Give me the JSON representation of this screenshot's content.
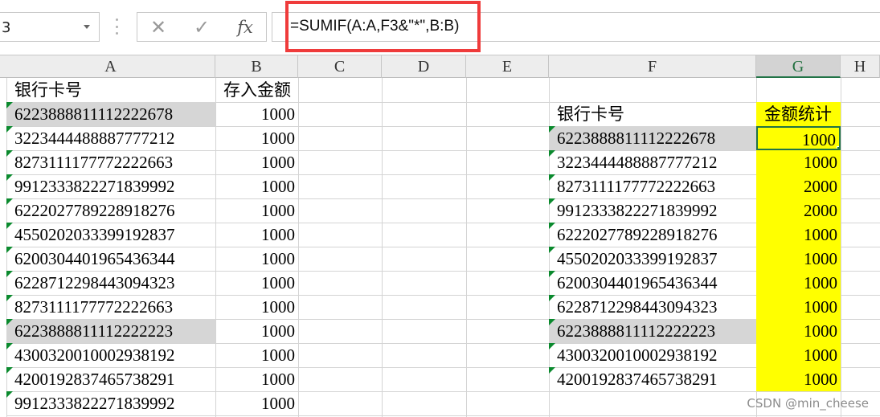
{
  "formula_bar": {
    "name_box_value": "3",
    "cancel_symbol": "✕",
    "enter_symbol": "✓",
    "fx_label": "fx",
    "formula": "=SUMIF(A:A,F3&\"*\",B:B)"
  },
  "columns": [
    "A",
    "B",
    "C",
    "D",
    "E",
    "F",
    "G",
    "H"
  ],
  "selected_column": "G",
  "sheet": {
    "col_a_header": "银行卡号",
    "col_b_header": "存入金额",
    "left_rows": [
      {
        "card": "6223888811112222678",
        "amount": "1000",
        "grey": true
      },
      {
        "card": "3223444488887777212",
        "amount": "1000",
        "grey": false
      },
      {
        "card": "8273111177772222663",
        "amount": "1000",
        "grey": false
      },
      {
        "card": "9912333822271839992",
        "amount": "1000",
        "grey": false
      },
      {
        "card": "6222027789228918276",
        "amount": "1000",
        "grey": false
      },
      {
        "card": "4550202033399192837",
        "amount": "1000",
        "grey": false
      },
      {
        "card": "6200304401965436344",
        "amount": "1000",
        "grey": false
      },
      {
        "card": "6228712298443094323",
        "amount": "1000",
        "grey": false
      },
      {
        "card": "8273111177772222663",
        "amount": "1000",
        "grey": false
      },
      {
        "card": "6223888811112222223",
        "amount": "1000",
        "grey": true
      },
      {
        "card": "4300320010002938192",
        "amount": "1000",
        "grey": false
      },
      {
        "card": "4200192837465738291",
        "amount": "1000",
        "grey": false
      },
      {
        "card": "9912333822271839992",
        "amount": "1000",
        "grey": false
      }
    ],
    "col_f_header": "银行卡号",
    "col_g_header": "金额统计",
    "right_rows": [
      {
        "card": "6223888811112222678",
        "total": "1000",
        "grey": true
      },
      {
        "card": "3223444488887777212",
        "total": "1000",
        "grey": false
      },
      {
        "card": "8273111177772222663",
        "total": "2000",
        "grey": false
      },
      {
        "card": "9912333822271839992",
        "total": "2000",
        "grey": false
      },
      {
        "card": "6222027789228918276",
        "total": "1000",
        "grey": false
      },
      {
        "card": "4550202033399192837",
        "total": "1000",
        "grey": false
      },
      {
        "card": "6200304401965436344",
        "total": "1000",
        "grey": false
      },
      {
        "card": "6228712298443094323",
        "total": "1000",
        "grey": false
      },
      {
        "card": "6223888811112222223",
        "total": "1000",
        "grey": true
      },
      {
        "card": "4300320010002938192",
        "total": "1000",
        "grey": false
      },
      {
        "card": "4200192837465738291",
        "total": "1000",
        "grey": false
      }
    ]
  },
  "colors": {
    "highlight_box": "#ef3b3b",
    "yellow_fill": "#ffff00",
    "grey_fill": "#d6d6d6",
    "text_indicator": "#0b8a2e",
    "selection_border": "#217346"
  },
  "watermark": "CSDN @min_cheese"
}
